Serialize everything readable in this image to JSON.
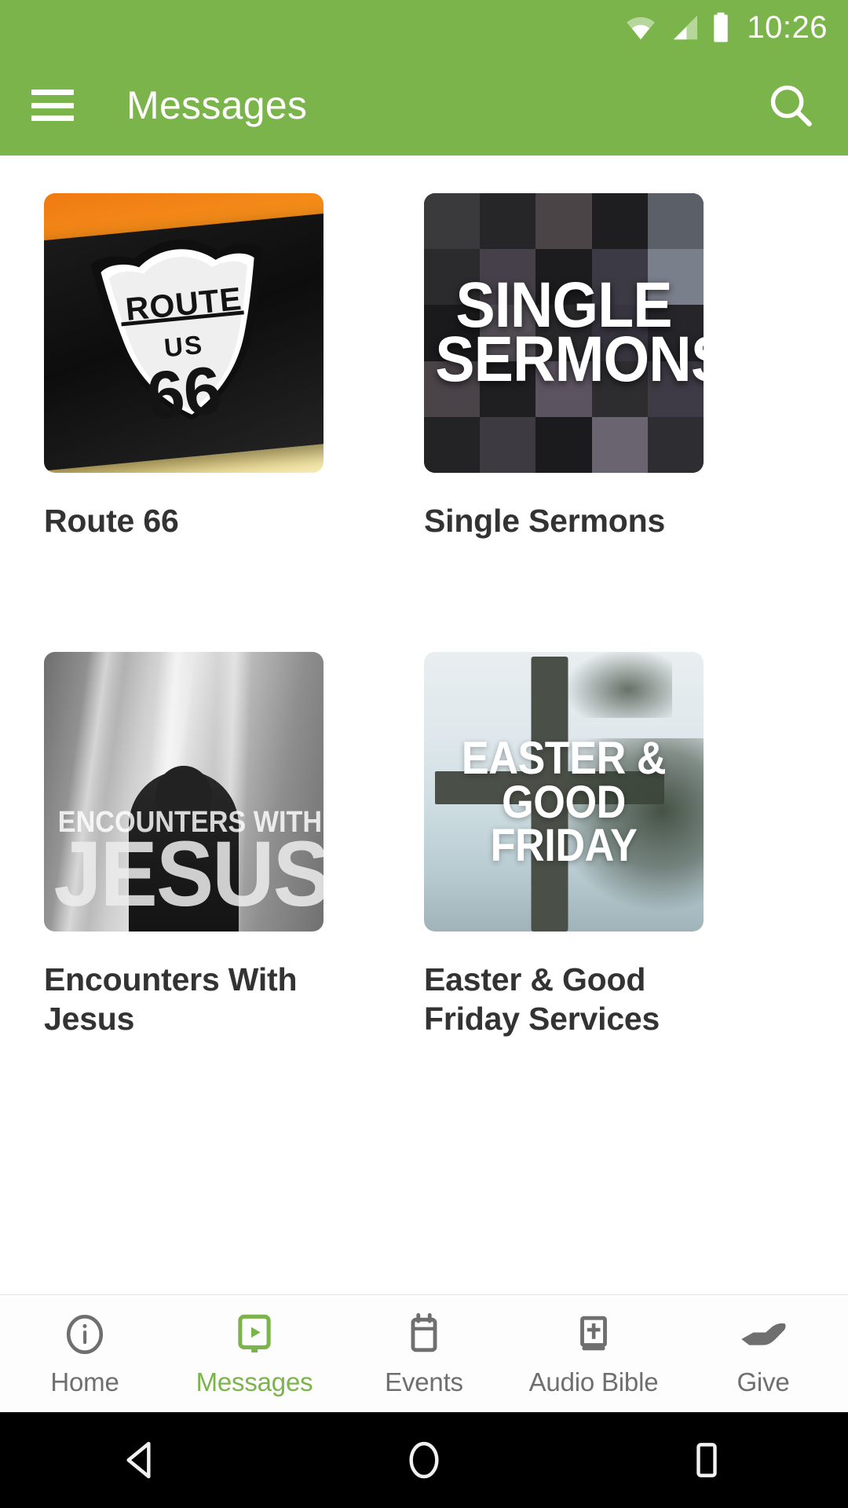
{
  "status_bar": {
    "time": "10:26",
    "icons": [
      "wifi-icon",
      "cellular-signal-icon",
      "battery-icon"
    ]
  },
  "app_bar": {
    "title": "Messages",
    "menu_icon": "hamburger-menu-icon",
    "search_icon": "search-icon",
    "background_color": "#7BB44A"
  },
  "series_grid": {
    "items": [
      {
        "title": "Route 66",
        "thumbnail": "route-66-highway-shield-artwork",
        "art_text": {
          "line1": "ROUTE",
          "line2": "US",
          "line3": "66"
        }
      },
      {
        "title": "Single Sermons",
        "thumbnail": "single-sermons-church-collage-artwork",
        "art_text": {
          "line1": "SINGLE",
          "line2": "SERMONS"
        }
      },
      {
        "title": "Encounters With Jesus",
        "thumbnail": "encounters-with-jesus-artwork",
        "art_text": {
          "line1": "ENCOUNTERS WITH",
          "line2": "JESUS"
        }
      },
      {
        "title": "Easter & Good Friday Services",
        "thumbnail": "easter-good-friday-cross-artwork",
        "art_text": {
          "line1": "EASTER &",
          "line2": "GOOD FRIDAY"
        }
      }
    ]
  },
  "tab_bar": {
    "active_color": "#7BB44A",
    "inactive_color": "#6F6F6F",
    "tabs": [
      {
        "label": "Home",
        "icon": "info-circle-icon",
        "active": false
      },
      {
        "label": "Messages",
        "icon": "video-screen-play-icon",
        "active": true
      },
      {
        "label": "Events",
        "icon": "calendar-icon",
        "active": false
      },
      {
        "label": "Audio Bible",
        "icon": "bible-book-cross-icon",
        "active": false
      },
      {
        "label": "Give",
        "icon": "giving-hand-icon",
        "active": false
      }
    ]
  },
  "system_nav": {
    "buttons": [
      {
        "name": "back",
        "icon": "back-triangle-icon"
      },
      {
        "name": "home",
        "icon": "home-circle-icon"
      },
      {
        "name": "recents",
        "icon": "recents-square-icon"
      }
    ]
  }
}
